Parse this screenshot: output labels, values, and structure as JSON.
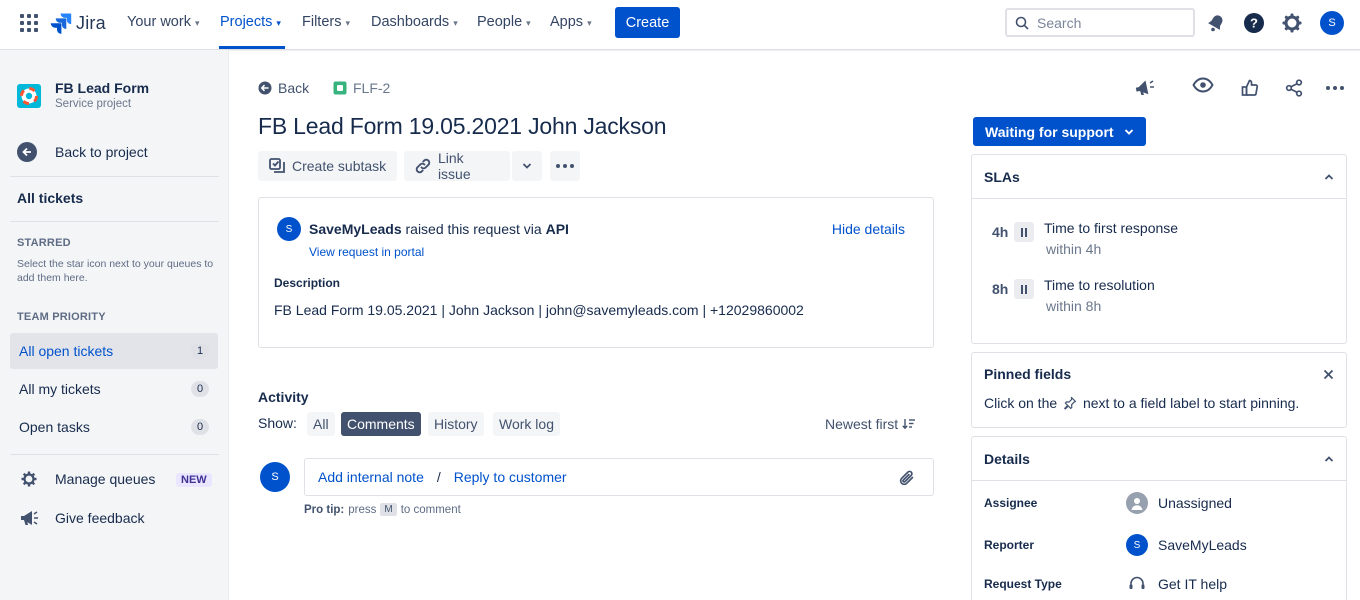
{
  "topnav": {
    "product": "Jira",
    "items": [
      {
        "label": "Your work"
      },
      {
        "label": "Projects"
      },
      {
        "label": "Filters"
      },
      {
        "label": "Dashboards"
      },
      {
        "label": "People"
      },
      {
        "label": "Apps"
      }
    ],
    "create_label": "Create",
    "search_placeholder": "Search",
    "user_initial": "S",
    "icons": [
      "notifications-icon",
      "help-icon",
      "settings-icon"
    ]
  },
  "sidebar": {
    "project_name": "FB Lead Form",
    "project_type": "Service project",
    "back_label": "Back to project",
    "all_tickets": "All tickets",
    "starred_heading": "STARRED",
    "starred_note": "Select the star icon next to your queues to add them here.",
    "team_priority_heading": "TEAM PRIORITY",
    "queues": [
      {
        "label": "All open tickets",
        "count": "1"
      },
      {
        "label": "All my tickets",
        "count": "0"
      },
      {
        "label": "Open tasks",
        "count": "0"
      }
    ],
    "manage_queues": "Manage queues",
    "new_badge": "NEW",
    "give_feedback": "Give feedback"
  },
  "issue": {
    "back_label": "Back",
    "key": "FLF-2",
    "title": "FB Lead Form 19.05.2021 John Jackson",
    "create_subtask": "Create subtask",
    "link_issue": "Link issue",
    "request": {
      "avatar_initial": "S",
      "reporter": "SaveMyLeads",
      "raised_text": "raised this request via",
      "channel": "API",
      "view_portal": "View request in portal",
      "hide_details": "Hide details",
      "description_label": "Description",
      "description": "FB Lead Form 19.05.2021 | John Jackson | john@savemyleads.com | +12029860002"
    }
  },
  "activity": {
    "title": "Activity",
    "show_label": "Show:",
    "filters": [
      {
        "label": "All"
      },
      {
        "label": "Comments"
      },
      {
        "label": "History"
      },
      {
        "label": "Work log"
      }
    ],
    "active_filter": "Comments",
    "sort_label": "Newest first",
    "avatar_initial": "S",
    "add_internal_note": "Add internal note",
    "separator": "/",
    "reply_to_customer": "Reply to customer",
    "pro_tip_label": "Pro tip:",
    "pro_tip_press": "press",
    "pro_tip_key": "M",
    "pro_tip_rest": "to comment"
  },
  "right": {
    "status": "Waiting for support",
    "slas_title": "SLAs",
    "slas": [
      {
        "time": "4h",
        "name": "Time to first response",
        "goal": "within 4h"
      },
      {
        "time": "8h",
        "name": "Time to resolution",
        "goal": "within 8h"
      }
    ],
    "pinned_title": "Pinned fields",
    "pinned_text_before": "Click on the",
    "pinned_text_after": "next to a field label to start pinning.",
    "details_title": "Details",
    "details": [
      {
        "label": "Assignee",
        "value": "Unassigned"
      },
      {
        "label": "Reporter",
        "value": "SaveMyLeads",
        "initial": "S"
      },
      {
        "label": "Request Type",
        "value": "Get IT help"
      }
    ]
  },
  "colors": {
    "brand": "#0052CC",
    "sidebar_bg": "#F4F5F7",
    "text": "#172B4D",
    "subtle": "#6B778C",
    "new_badge_bg": "#EAE6FF",
    "project_icon": "#00B8D9"
  }
}
